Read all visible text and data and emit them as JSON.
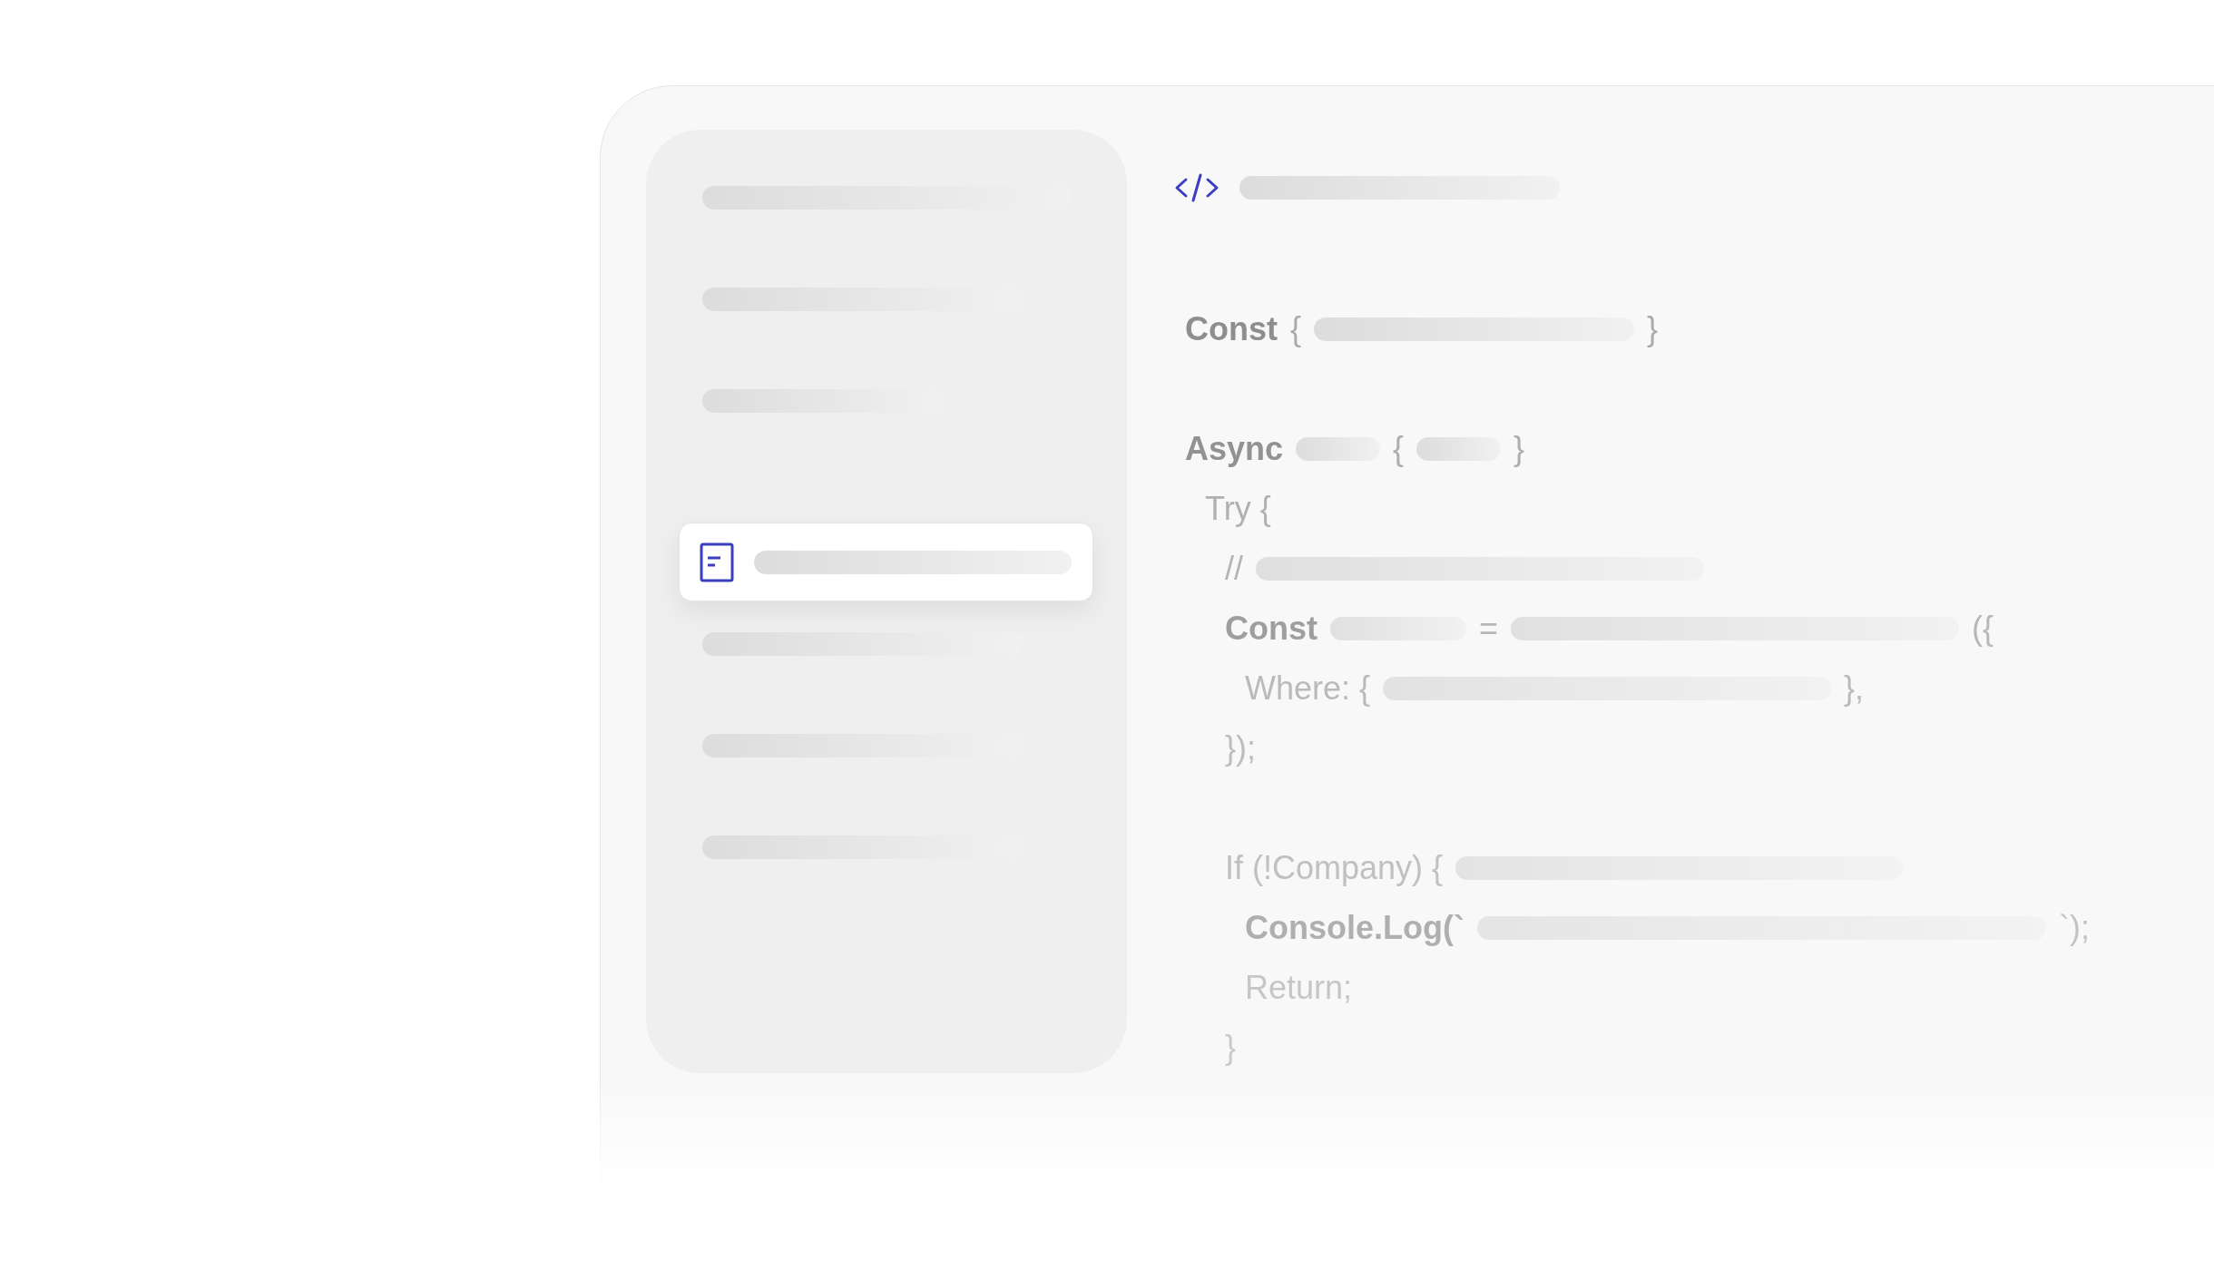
{
  "sidebar": {
    "items": [
      {
        "selected": false
      },
      {
        "selected": false
      },
      {
        "selected": false
      },
      {
        "selected": true
      },
      {
        "selected": false
      },
      {
        "selected": false
      },
      {
        "selected": false
      }
    ]
  },
  "editor": {
    "lines": [
      {
        "tokens": [
          {
            "kind": "text",
            "text": "Const",
            "strong": true
          },
          {
            "kind": "text",
            "text": "{",
            "strong": false
          },
          {
            "kind": "midbar"
          },
          {
            "kind": "text",
            "text": "}",
            "strong": false
          }
        ]
      },
      {
        "tokens": [
          {
            "kind": "text",
            "text": "Async",
            "strong": true
          },
          {
            "kind": "stub"
          },
          {
            "kind": "text",
            "text": "{",
            "strong": false
          },
          {
            "kind": "stub"
          },
          {
            "kind": "text",
            "text": "}",
            "strong": false
          }
        ],
        "children": [
          {
            "tokens": [
              {
                "kind": "text",
                "text": "Try {",
                "strong": false
              }
            ],
            "children": [
              {
                "tokens": [
                  {
                    "kind": "text",
                    "text": "//",
                    "strong": false
                  },
                  {
                    "kind": "bar"
                  }
                ]
              },
              {
                "tokens": [
                  {
                    "kind": "text",
                    "text": "Const",
                    "strong": true
                  },
                  {
                    "kind": "chip"
                  },
                  {
                    "kind": "text",
                    "text": "=",
                    "strong": false
                  },
                  {
                    "kind": "bar"
                  },
                  {
                    "kind": "text",
                    "text": "({",
                    "strong": false
                  }
                ],
                "children": [
                  {
                    "tokens": [
                      {
                        "kind": "text",
                        "text": "Where: {",
                        "strong": false
                      },
                      {
                        "kind": "bar"
                      },
                      {
                        "kind": "text",
                        "text": "},",
                        "strong": false
                      }
                    ]
                  }
                ]
              },
              {
                "tokens": [
                  {
                    "kind": "text",
                    "text": "});",
                    "strong": false
                  }
                ]
              },
              {
                "tokens": [
                  {
                    "kind": "text",
                    "text": "If (!Company) {",
                    "strong": false
                  },
                  {
                    "kind": "bar"
                  }
                ],
                "children": [
                  {
                    "tokens": [
                      {
                        "kind": "text",
                        "text": "Console.Log(`",
                        "strong": true
                      },
                      {
                        "kind": "longbar"
                      },
                      {
                        "kind": "text",
                        "text": "`);",
                        "strong": false
                      }
                    ]
                  },
                  {
                    "tokens": [
                      {
                        "kind": "text",
                        "text": "Return;",
                        "strong": false
                      }
                    ]
                  }
                ]
              },
              {
                "tokens": [
                  {
                    "kind": "text",
                    "text": "}",
                    "strong": false
                  }
                ]
              }
            ]
          }
        ]
      }
    ]
  }
}
